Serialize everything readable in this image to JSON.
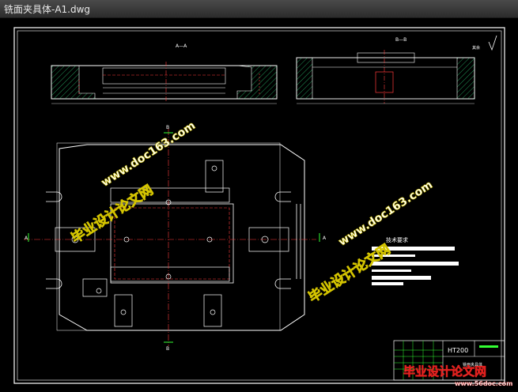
{
  "window": {
    "title": "铣面夹具体-A1.dwg"
  },
  "drawing": {
    "view_a_label": "A—A",
    "view_b_label": "B—B",
    "roughness_label": "其余",
    "section_letter_a": "A",
    "section_letter_b": "B",
    "tech_req_title": "技术要求",
    "material": "HT200",
    "part_name": "铣面夹具体"
  },
  "watermarks": {
    "site": "www.doc163.com",
    "cn": "毕业设计论文网",
    "badge_site": "www.56doc.com",
    "badge_cn": "毕业设计论文网"
  },
  "colors": {
    "frame": "#ffffff",
    "outline": "#ffffff",
    "hidden": "#ff3b3b",
    "center": "#ff3b3b",
    "hatch": "#2fd07a",
    "dim": "#ffffff",
    "accent_green": "#33ff33",
    "watermark_fill": "#ffffff",
    "watermark_stroke": "#d4c400",
    "watermark_red": "#e0201e"
  }
}
